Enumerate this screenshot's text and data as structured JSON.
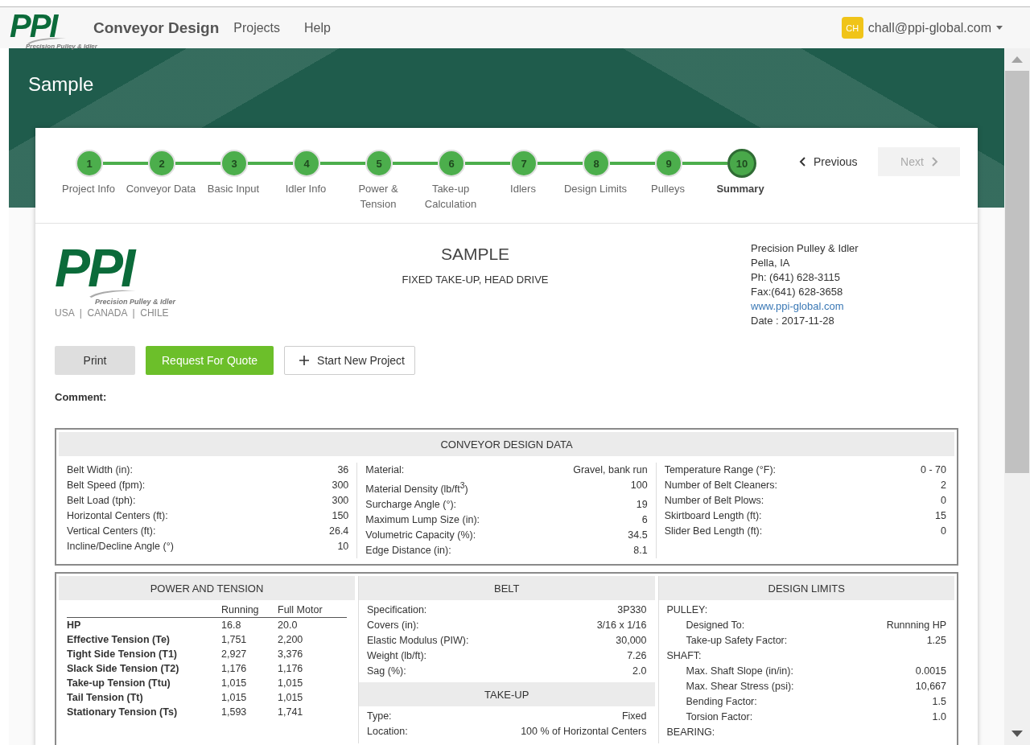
{
  "nav": {
    "logo": {
      "mark": "PPI",
      "tagline": "Precision Pulley & Idler"
    },
    "brand": "Conveyor Design",
    "links": [
      "Projects",
      "Help"
    ],
    "user": {
      "initials": "CH",
      "email": "chall@ppi-global.com"
    }
  },
  "page_title": "Sample",
  "steps": [
    {
      "number": "1",
      "label": "Project Info",
      "selected": false
    },
    {
      "number": "2",
      "label": "Conveyor Data",
      "selected": false
    },
    {
      "number": "3",
      "label": "Basic Input",
      "selected": false
    },
    {
      "number": "4",
      "label": "Idler Info",
      "selected": false
    },
    {
      "number": "5",
      "label": "Power & Tension",
      "selected": false
    },
    {
      "number": "6",
      "label": "Take-up Calculation",
      "selected": false
    },
    {
      "number": "7",
      "label": "Idlers",
      "selected": false
    },
    {
      "number": "8",
      "label": "Design Limits",
      "selected": false
    },
    {
      "number": "9",
      "label": "Pulleys",
      "selected": false
    },
    {
      "number": "10",
      "label": "Summary",
      "selected": true
    }
  ],
  "pager": {
    "previous": {
      "label": "Previous",
      "disabled": false
    },
    "next": {
      "label": "Next",
      "disabled": true
    }
  },
  "report": {
    "logo": {
      "mark": "PPI",
      "tagline": "Precision Pulley & Idler",
      "regions": "USA  |  CANADA  |  CHILE"
    },
    "title": "SAMPLE",
    "subtitle": "FIXED TAKE-UP, HEAD DRIVE",
    "company": [
      "Precision Pulley & Idler",
      "Pella, IA",
      "Ph: (641) 628-3115",
      "Fax:(641) 628-3658"
    ],
    "website": "www.ppi-global.com",
    "date": "Date : 2017-11-28"
  },
  "actions": [
    {
      "label": "Print",
      "kind": "secondary"
    },
    {
      "label": "Request For Quote",
      "kind": "primary"
    },
    {
      "label": "Start New Project",
      "kind": "add"
    }
  ],
  "comment_label": "Comment:",
  "design_data": {
    "title": "CONVEYOR DESIGN DATA",
    "columns": [
      [
        {
          "label": "Belt Width (in):",
          "value": "36"
        },
        {
          "label": "Belt Speed (fpm):",
          "value": "300"
        },
        {
          "label": "Belt Load (tph):",
          "value": "300"
        },
        {
          "label": "Horizontal Centers (ft):",
          "value": "150"
        },
        {
          "label": "Vertical Centers (ft):",
          "value": "26.4"
        },
        {
          "label": "Incline/Decline Angle (°)",
          "value": "10"
        }
      ],
      [
        {
          "label": "Material:",
          "value": "Gravel, bank run"
        },
        {
          "label": "Material Density (lb/ft$^{3}$)",
          "value": "100"
        },
        {
          "label": "Surcharge Angle (°):",
          "value": "19"
        },
        {
          "label": "Maximum Lump Size (in):",
          "value": "6"
        },
        {
          "label": "Volumetric Capacity (%):",
          "value": "34.5"
        },
        {
          "label": "Edge Distance (in):",
          "value": "8.1"
        }
      ],
      [
        {
          "label": "Temperature Range (°F):",
          "value": "0 - 70"
        },
        {
          "label": "Number of Belt Cleaners:",
          "value": "2"
        },
        {
          "label": "Number of Belt Plows:",
          "value": "0"
        },
        {
          "label": "Skirtboard Length (ft):",
          "value": "15"
        },
        {
          "label": "Slider Bed Length (ft):",
          "value": "0"
        }
      ]
    ]
  },
  "power_tension": {
    "title": "POWER AND TENSION",
    "columns": [
      "Running",
      "Full Motor"
    ],
    "rows": [
      {
        "label": "HP",
        "running": "16.8",
        "full": "20.0"
      },
      {
        "label": "Effective Tension (Te)",
        "running": "1,751",
        "full": "2,200"
      },
      {
        "label": "Tight Side Tension (T1)",
        "running": "2,927",
        "full": "3,376"
      },
      {
        "label": "Slack Side Tension (T2)",
        "running": "1,176",
        "full": "1,176"
      },
      {
        "label": "Take-up Tension (Ttu)",
        "running": "1,015",
        "full": "1,015"
      },
      {
        "label": "Tail Tension (Tt)",
        "running": "1,015",
        "full": "1,015"
      },
      {
        "label": "Stationary Tension (Ts)",
        "running": "1,593",
        "full": "1,741"
      }
    ]
  },
  "belt": {
    "title": "BELT",
    "rows": [
      {
        "label": "Specification:",
        "value": "3P330"
      },
      {
        "label": "Covers (in):",
        "value": "3/16 x 1/16"
      },
      {
        "label": "Elastic Modulus (PIW):",
        "value": "30,000"
      },
      {
        "label": "Weight (lb/ft):",
        "value": "7.26"
      },
      {
        "label": "Sag (%):",
        "value": "2.0"
      }
    ]
  },
  "take_up": {
    "title": "TAKE-UP",
    "rows": [
      {
        "label": "Type:",
        "value": "Fixed"
      },
      {
        "label": "Location:",
        "value": "100 % of Horizontal Centers"
      }
    ]
  },
  "design_limits": {
    "title": "DESIGN LIMITS",
    "groups": [
      {
        "name": "PULLEY:",
        "rows": [
          {
            "label": "Designed To:",
            "value": "Runnning HP"
          },
          {
            "label": "Take-up Safety Factor:",
            "value": "1.25"
          }
        ]
      },
      {
        "name": "SHAFT:",
        "rows": [
          {
            "label": "Max. Shaft Slope (in/in):",
            "value": "0.0015"
          },
          {
            "label": "Max. Shear Stress (psi):",
            "value": "10,667"
          },
          {
            "label": "Bending Factor:",
            "value": "1.5"
          },
          {
            "label": "Torsion Factor:",
            "value": "1.0"
          }
        ]
      },
      {
        "name": "BEARING:"
      }
    ]
  }
}
